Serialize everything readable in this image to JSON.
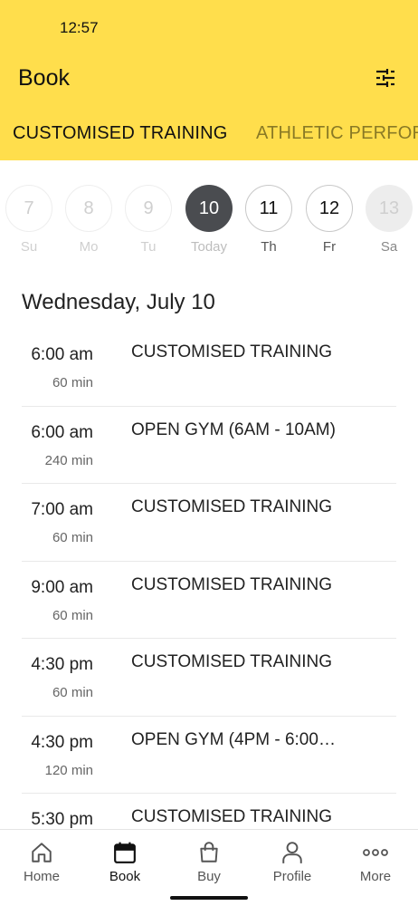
{
  "status_bar": {
    "time": "12:57"
  },
  "header": {
    "title": "Book",
    "filter_icon": "sliders-icon"
  },
  "tabs": [
    {
      "label": "CUSTOMISED TRAINING",
      "active": true
    },
    {
      "label": "ATHLETIC PERFOR",
      "active": false
    }
  ],
  "dates": [
    {
      "day": "7",
      "label": "Su",
      "state": "past"
    },
    {
      "day": "8",
      "label": "Mo",
      "state": "past"
    },
    {
      "day": "9",
      "label": "Tu",
      "state": "past"
    },
    {
      "day": "10",
      "label": "Today",
      "state": "selected"
    },
    {
      "day": "11",
      "label": "Th",
      "state": "future"
    },
    {
      "day": "12",
      "label": "Fr",
      "state": "future"
    },
    {
      "day": "13",
      "label": "Sa",
      "state": "disabled"
    }
  ],
  "day_heading": "Wednesday, July 10",
  "sessions": [
    {
      "time": "6:00 am",
      "duration": "60 min",
      "name": "CUSTOMISED TRAINING"
    },
    {
      "time": "6:00 am",
      "duration": "240 min",
      "name": "OPEN GYM (6AM - 10AM)"
    },
    {
      "time": "7:00 am",
      "duration": "60 min",
      "name": "CUSTOMISED TRAINING"
    },
    {
      "time": "9:00 am",
      "duration": "60 min",
      "name": "CUSTOMISED TRAINING"
    },
    {
      "time": "4:30 pm",
      "duration": "60 min",
      "name": "CUSTOMISED TRAINING"
    },
    {
      "time": "4:30 pm",
      "duration": "120 min",
      "name": "OPEN GYM (4PM - 6:00…"
    },
    {
      "time": "5:30 pm",
      "duration": "",
      "name": "CUSTOMISED TRAINING"
    }
  ],
  "bottom_nav": [
    {
      "label": "Home",
      "icon": "home-icon",
      "active": false
    },
    {
      "label": "Book",
      "icon": "calendar-icon",
      "active": true
    },
    {
      "label": "Buy",
      "icon": "shopping-bag-icon",
      "active": false
    },
    {
      "label": "Profile",
      "icon": "person-icon",
      "active": false
    },
    {
      "label": "More",
      "icon": "more-dots-icon",
      "active": false
    }
  ],
  "colors": {
    "header_bg": "#FFDE4C",
    "selected_date": "#4A4C50"
  }
}
